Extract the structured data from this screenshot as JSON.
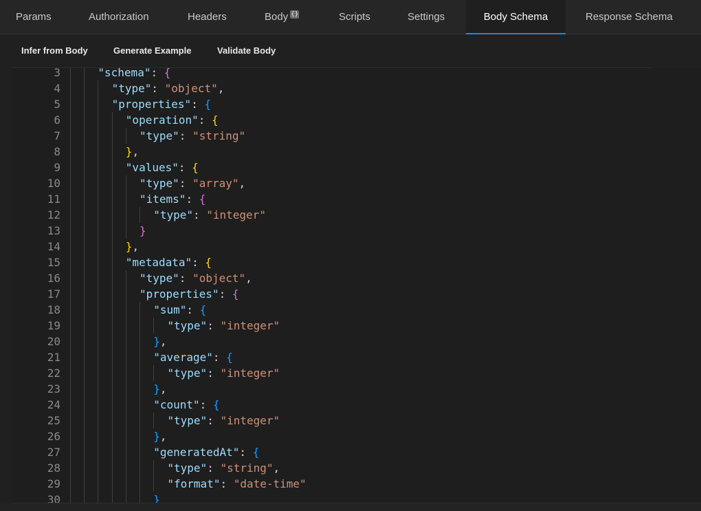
{
  "tabs": [
    {
      "label": "Params",
      "active": false
    },
    {
      "label": "Authorization",
      "active": false
    },
    {
      "label": "Headers",
      "active": false
    },
    {
      "label": "Body",
      "active": false,
      "badge": "{}"
    },
    {
      "label": "Scripts",
      "active": false
    },
    {
      "label": "Settings",
      "active": false
    },
    {
      "label": "Body Schema",
      "active": true
    },
    {
      "label": "Response Schema",
      "active": false
    }
  ],
  "toolbar": {
    "infer_label": "Infer from Body",
    "generate_label": "Generate Example",
    "validate_label": "Validate Body"
  },
  "editor": {
    "lines": [
      {
        "n": "3",
        "depth": 2,
        "tokens": [
          [
            "k",
            "\"schema\""
          ],
          [
            "p",
            ": "
          ],
          [
            "b2",
            "{"
          ]
        ]
      },
      {
        "n": "4",
        "depth": 3,
        "tokens": [
          [
            "k",
            "\"type\""
          ],
          [
            "p",
            ": "
          ],
          [
            "s",
            "\"object\""
          ],
          [
            "p",
            ","
          ]
        ]
      },
      {
        "n": "5",
        "depth": 3,
        "tokens": [
          [
            "k",
            "\"properties\""
          ],
          [
            "p",
            ": "
          ],
          [
            "b3",
            "{"
          ]
        ]
      },
      {
        "n": "6",
        "depth": 4,
        "tokens": [
          [
            "k",
            "\"operation\""
          ],
          [
            "p",
            ": "
          ],
          [
            "b1",
            "{"
          ]
        ]
      },
      {
        "n": "7",
        "depth": 5,
        "tokens": [
          [
            "k",
            "\"type\""
          ],
          [
            "p",
            ": "
          ],
          [
            "s",
            "\"string\""
          ]
        ]
      },
      {
        "n": "8",
        "depth": 4,
        "tokens": [
          [
            "b1",
            "}"
          ],
          [
            "p",
            ","
          ]
        ]
      },
      {
        "n": "9",
        "depth": 4,
        "tokens": [
          [
            "k",
            "\"values\""
          ],
          [
            "p",
            ": "
          ],
          [
            "b1",
            "{"
          ]
        ]
      },
      {
        "n": "10",
        "depth": 5,
        "tokens": [
          [
            "k",
            "\"type\""
          ],
          [
            "p",
            ": "
          ],
          [
            "s",
            "\"array\""
          ],
          [
            "p",
            ","
          ]
        ]
      },
      {
        "n": "11",
        "depth": 5,
        "tokens": [
          [
            "k",
            "\"items\""
          ],
          [
            "p",
            ": "
          ],
          [
            "b2",
            "{"
          ]
        ]
      },
      {
        "n": "12",
        "depth": 6,
        "tokens": [
          [
            "k",
            "\"type\""
          ],
          [
            "p",
            ": "
          ],
          [
            "s",
            "\"integer\""
          ]
        ]
      },
      {
        "n": "13",
        "depth": 5,
        "tokens": [
          [
            "b2",
            "}"
          ]
        ]
      },
      {
        "n": "14",
        "depth": 4,
        "tokens": [
          [
            "b1",
            "}"
          ],
          [
            "p",
            ","
          ]
        ]
      },
      {
        "n": "15",
        "depth": 4,
        "tokens": [
          [
            "k",
            "\"metadata\""
          ],
          [
            "p",
            ": "
          ],
          [
            "b1",
            "{"
          ]
        ]
      },
      {
        "n": "16",
        "depth": 5,
        "tokens": [
          [
            "k",
            "\"type\""
          ],
          [
            "p",
            ": "
          ],
          [
            "s",
            "\"object\""
          ],
          [
            "p",
            ","
          ]
        ]
      },
      {
        "n": "17",
        "depth": 5,
        "tokens": [
          [
            "k",
            "\"properties\""
          ],
          [
            "p",
            ": "
          ],
          [
            "b2",
            "{"
          ]
        ]
      },
      {
        "n": "18",
        "depth": 6,
        "tokens": [
          [
            "k",
            "\"sum\""
          ],
          [
            "p",
            ": "
          ],
          [
            "b3",
            "{"
          ]
        ]
      },
      {
        "n": "19",
        "depth": 7,
        "tokens": [
          [
            "k",
            "\"type\""
          ],
          [
            "p",
            ": "
          ],
          [
            "s",
            "\"integer\""
          ]
        ]
      },
      {
        "n": "20",
        "depth": 6,
        "tokens": [
          [
            "b3",
            "}"
          ],
          [
            "p",
            ","
          ]
        ]
      },
      {
        "n": "21",
        "depth": 6,
        "tokens": [
          [
            "k",
            "\"average\""
          ],
          [
            "p",
            ": "
          ],
          [
            "b3",
            "{"
          ]
        ]
      },
      {
        "n": "22",
        "depth": 7,
        "tokens": [
          [
            "k",
            "\"type\""
          ],
          [
            "p",
            ": "
          ],
          [
            "s",
            "\"integer\""
          ]
        ]
      },
      {
        "n": "23",
        "depth": 6,
        "tokens": [
          [
            "b3",
            "}"
          ],
          [
            "p",
            ","
          ]
        ]
      },
      {
        "n": "24",
        "depth": 6,
        "tokens": [
          [
            "k",
            "\"count\""
          ],
          [
            "p",
            ": "
          ],
          [
            "b3",
            "{"
          ]
        ]
      },
      {
        "n": "25",
        "depth": 7,
        "tokens": [
          [
            "k",
            "\"type\""
          ],
          [
            "p",
            ": "
          ],
          [
            "s",
            "\"integer\""
          ]
        ]
      },
      {
        "n": "26",
        "depth": 6,
        "tokens": [
          [
            "b3",
            "}"
          ],
          [
            "p",
            ","
          ]
        ]
      },
      {
        "n": "27",
        "depth": 6,
        "tokens": [
          [
            "k",
            "\"generatedAt\""
          ],
          [
            "p",
            ": "
          ],
          [
            "b3",
            "{"
          ]
        ]
      },
      {
        "n": "28",
        "depth": 7,
        "tokens": [
          [
            "k",
            "\"type\""
          ],
          [
            "p",
            ": "
          ],
          [
            "s",
            "\"string\""
          ],
          [
            "p",
            ","
          ]
        ]
      },
      {
        "n": "29",
        "depth": 7,
        "tokens": [
          [
            "k",
            "\"format\""
          ],
          [
            "p",
            ": "
          ],
          [
            "s",
            "\"date-time\""
          ]
        ]
      },
      {
        "n": "30",
        "depth": 6,
        "tokens": [
          [
            "b3",
            "}"
          ]
        ]
      }
    ]
  }
}
